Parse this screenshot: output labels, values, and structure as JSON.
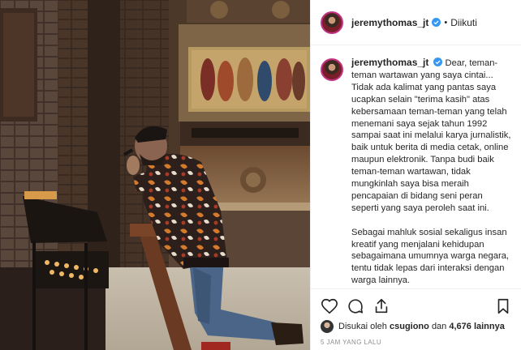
{
  "post": {
    "username": "jeremythomas_jt",
    "follow_state": "Diikuti",
    "separator": "•",
    "caption_paragraph_1": "Dear, teman-teman wartawan yang saya cintai... Tidak ada kalimat yang pantas saya ucapkan selain \"terima kasih\" atas kebersamaan teman-teman yang telah menemani saya sejak tahun 1992 sampai saat ini melalui karya jurnalistik, baik untuk berita di media cetak, online maupun elektronik. Tanpa budi baik teman-teman wartawan, tidak mungkinlah saya bisa meraih pencapaian di bidang seni peran seperti yang saya peroleh saat ini.",
    "caption_paragraph_2": "Sebagai mahluk sosial sekaligus insan kreatif yang menjalani kehidupan sebagaimana umumnya warga negara, tentu tidak lepas dari interaksi dengan warga lainnya.",
    "likes_prefix": "Disukai oleh",
    "likes_user": "csugiono",
    "likes_joiner": "dan",
    "likes_count": "4,676 lainnya",
    "timestamp": "5 JAM YANG LALU"
  },
  "icons": {
    "verified": "verified-badge-icon",
    "like": "heart-icon",
    "comment": "comment-icon",
    "share": "share-icon",
    "save": "bookmark-icon"
  },
  "colors": {
    "verified_blue": "#3897f0",
    "text": "#262626",
    "muted": "#8e8e8e",
    "border": "#efefef"
  }
}
